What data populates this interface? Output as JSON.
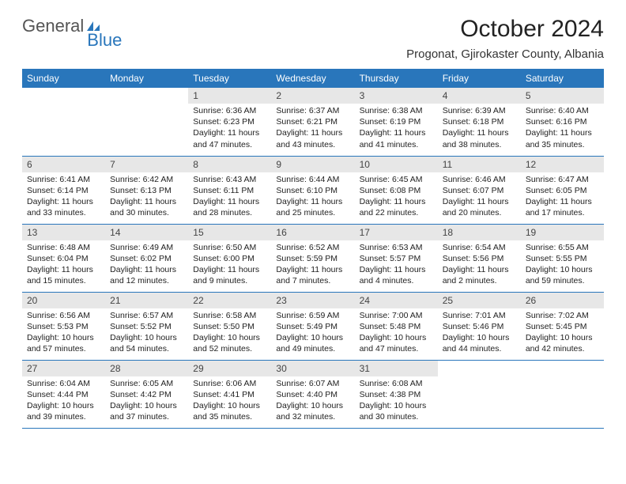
{
  "logo": {
    "part1": "General",
    "part2": "Blue"
  },
  "title": "October 2024",
  "subtitle": "Progonat, Gjirokaster County, Albania",
  "weekdays": [
    "Sunday",
    "Monday",
    "Tuesday",
    "Wednesday",
    "Thursday",
    "Friday",
    "Saturday"
  ],
  "weeks": [
    [
      null,
      null,
      {
        "n": "1",
        "sr": "6:36 AM",
        "ss": "6:23 PM",
        "dl": "11 hours and 47 minutes."
      },
      {
        "n": "2",
        "sr": "6:37 AM",
        "ss": "6:21 PM",
        "dl": "11 hours and 43 minutes."
      },
      {
        "n": "3",
        "sr": "6:38 AM",
        "ss": "6:19 PM",
        "dl": "11 hours and 41 minutes."
      },
      {
        "n": "4",
        "sr": "6:39 AM",
        "ss": "6:18 PM",
        "dl": "11 hours and 38 minutes."
      },
      {
        "n": "5",
        "sr": "6:40 AM",
        "ss": "6:16 PM",
        "dl": "11 hours and 35 minutes."
      }
    ],
    [
      {
        "n": "6",
        "sr": "6:41 AM",
        "ss": "6:14 PM",
        "dl": "11 hours and 33 minutes."
      },
      {
        "n": "7",
        "sr": "6:42 AM",
        "ss": "6:13 PM",
        "dl": "11 hours and 30 minutes."
      },
      {
        "n": "8",
        "sr": "6:43 AM",
        "ss": "6:11 PM",
        "dl": "11 hours and 28 minutes."
      },
      {
        "n": "9",
        "sr": "6:44 AM",
        "ss": "6:10 PM",
        "dl": "11 hours and 25 minutes."
      },
      {
        "n": "10",
        "sr": "6:45 AM",
        "ss": "6:08 PM",
        "dl": "11 hours and 22 minutes."
      },
      {
        "n": "11",
        "sr": "6:46 AM",
        "ss": "6:07 PM",
        "dl": "11 hours and 20 minutes."
      },
      {
        "n": "12",
        "sr": "6:47 AM",
        "ss": "6:05 PM",
        "dl": "11 hours and 17 minutes."
      }
    ],
    [
      {
        "n": "13",
        "sr": "6:48 AM",
        "ss": "6:04 PM",
        "dl": "11 hours and 15 minutes."
      },
      {
        "n": "14",
        "sr": "6:49 AM",
        "ss": "6:02 PM",
        "dl": "11 hours and 12 minutes."
      },
      {
        "n": "15",
        "sr": "6:50 AM",
        "ss": "6:00 PM",
        "dl": "11 hours and 9 minutes."
      },
      {
        "n": "16",
        "sr": "6:52 AM",
        "ss": "5:59 PM",
        "dl": "11 hours and 7 minutes."
      },
      {
        "n": "17",
        "sr": "6:53 AM",
        "ss": "5:57 PM",
        "dl": "11 hours and 4 minutes."
      },
      {
        "n": "18",
        "sr": "6:54 AM",
        "ss": "5:56 PM",
        "dl": "11 hours and 2 minutes."
      },
      {
        "n": "19",
        "sr": "6:55 AM",
        "ss": "5:55 PM",
        "dl": "10 hours and 59 minutes."
      }
    ],
    [
      {
        "n": "20",
        "sr": "6:56 AM",
        "ss": "5:53 PM",
        "dl": "10 hours and 57 minutes."
      },
      {
        "n": "21",
        "sr": "6:57 AM",
        "ss": "5:52 PM",
        "dl": "10 hours and 54 minutes."
      },
      {
        "n": "22",
        "sr": "6:58 AM",
        "ss": "5:50 PM",
        "dl": "10 hours and 52 minutes."
      },
      {
        "n": "23",
        "sr": "6:59 AM",
        "ss": "5:49 PM",
        "dl": "10 hours and 49 minutes."
      },
      {
        "n": "24",
        "sr": "7:00 AM",
        "ss": "5:48 PM",
        "dl": "10 hours and 47 minutes."
      },
      {
        "n": "25",
        "sr": "7:01 AM",
        "ss": "5:46 PM",
        "dl": "10 hours and 44 minutes."
      },
      {
        "n": "26",
        "sr": "7:02 AM",
        "ss": "5:45 PM",
        "dl": "10 hours and 42 minutes."
      }
    ],
    [
      {
        "n": "27",
        "sr": "6:04 AM",
        "ss": "4:44 PM",
        "dl": "10 hours and 39 minutes."
      },
      {
        "n": "28",
        "sr": "6:05 AM",
        "ss": "4:42 PM",
        "dl": "10 hours and 37 minutes."
      },
      {
        "n": "29",
        "sr": "6:06 AM",
        "ss": "4:41 PM",
        "dl": "10 hours and 35 minutes."
      },
      {
        "n": "30",
        "sr": "6:07 AM",
        "ss": "4:40 PM",
        "dl": "10 hours and 32 minutes."
      },
      {
        "n": "31",
        "sr": "6:08 AM",
        "ss": "4:38 PM",
        "dl": "10 hours and 30 minutes."
      },
      null,
      null
    ]
  ],
  "labels": {
    "sunrise": "Sunrise: ",
    "sunset": "Sunset: ",
    "daylight": "Daylight: "
  }
}
